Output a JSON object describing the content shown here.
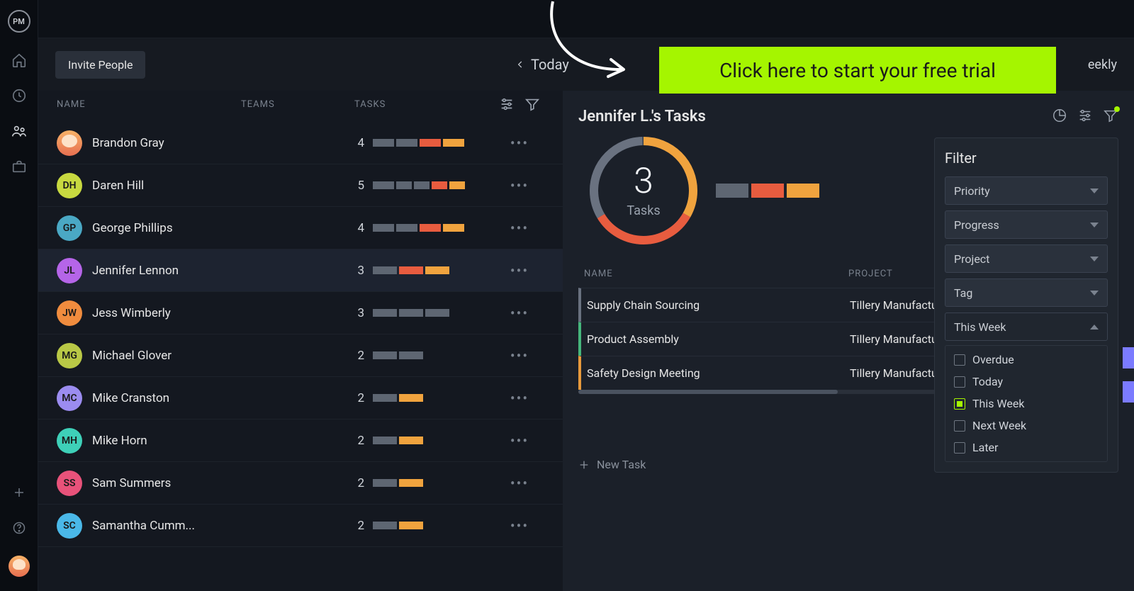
{
  "logo_text": "PM",
  "invite_label": "Invite People",
  "today_label": "Today",
  "view_label": "eekly",
  "cta_text": "Click here to start your free trial",
  "columns": {
    "name": "NAME",
    "teams": "TEAMS",
    "tasks": "TASKS"
  },
  "users": [
    {
      "name": "Brandon Gray",
      "initials": "",
      "color": "avatar-img",
      "tasks": 4,
      "bars": [
        [
          "gray",
          30
        ],
        [
          "gray",
          30
        ],
        [
          "red",
          30
        ],
        [
          "orange",
          30
        ]
      ],
      "selected": false,
      "avatarImg": true
    },
    {
      "name": "Daren Hill",
      "initials": "DH",
      "color": "#c8d940",
      "tasks": 5,
      "bars": [
        [
          "gray",
          30
        ],
        [
          "gray",
          22
        ],
        [
          "gray",
          22
        ],
        [
          "red",
          22
        ],
        [
          "orange",
          22
        ]
      ],
      "selected": false
    },
    {
      "name": "George Phillips",
      "initials": "GP",
      "color": "#4aa8c4",
      "tasks": 4,
      "bars": [
        [
          "gray",
          30
        ],
        [
          "gray",
          30
        ],
        [
          "red",
          30
        ],
        [
          "orange",
          30
        ]
      ],
      "selected": false
    },
    {
      "name": "Jennifer Lennon",
      "initials": "JL",
      "color": "#b565e8",
      "tasks": 3,
      "bars": [
        [
          "gray",
          34
        ],
        [
          "red",
          34
        ],
        [
          "orange",
          34
        ]
      ],
      "selected": true
    },
    {
      "name": "Jess Wimberly",
      "initials": "JW",
      "color": "#f08c3e",
      "tasks": 3,
      "bars": [
        [
          "gray",
          34
        ],
        [
          "gray",
          34
        ],
        [
          "gray",
          34
        ]
      ],
      "selected": false
    },
    {
      "name": "Michael Glover",
      "initials": "MG",
      "color": "#b9c846",
      "tasks": 2,
      "bars": [
        [
          "gray",
          34
        ],
        [
          "gray",
          34
        ]
      ],
      "selected": false
    },
    {
      "name": "Mike Cranston",
      "initials": "MC",
      "color": "#9b8cf0",
      "tasks": 2,
      "bars": [
        [
          "gray",
          34
        ],
        [
          "orange",
          34
        ]
      ],
      "selected": false
    },
    {
      "name": "Mike Horn",
      "initials": "MH",
      "color": "#3ed0b8",
      "tasks": 2,
      "bars": [
        [
          "gray",
          34
        ],
        [
          "orange",
          34
        ]
      ],
      "selected": false
    },
    {
      "name": "Sam Summers",
      "initials": "SS",
      "color": "#e8527a",
      "tasks": 2,
      "bars": [
        [
          "gray",
          34
        ],
        [
          "orange",
          34
        ]
      ],
      "selected": false
    },
    {
      "name": "Samantha Cumm...",
      "initials": "SC",
      "color": "#4ab8e8",
      "tasks": 2,
      "bars": [
        [
          "gray",
          34
        ],
        [
          "orange",
          34
        ]
      ],
      "selected": false
    }
  ],
  "detail": {
    "title": "Jennifer L.'s Tasks",
    "count": "3",
    "count_label": "Tasks",
    "mini_bars": [
      [
        "gray",
        46
      ],
      [
        "red",
        46
      ],
      [
        "orange",
        46
      ]
    ],
    "table_head": {
      "name": "NAME",
      "project": "PROJECT"
    },
    "tasks": [
      {
        "name": "Supply Chain Sourcing",
        "project": "Tillery Manufacturing",
        "border": "gray-l"
      },
      {
        "name": "Product Assembly",
        "project": "Tillery Manufacturing",
        "border": "green-l"
      },
      {
        "name": "Safety Design Meeting",
        "project": "Tillery Manufacturing",
        "border": "orange-l"
      }
    ],
    "new_task": "New Task"
  },
  "filter": {
    "title": "Filter",
    "selects": [
      "Priority",
      "Progress",
      "Project",
      "Tag"
    ],
    "open_select": "This Week",
    "options": [
      {
        "label": "Overdue",
        "checked": false
      },
      {
        "label": "Today",
        "checked": false
      },
      {
        "label": "This Week",
        "checked": true
      },
      {
        "label": "Next Week",
        "checked": false
      },
      {
        "label": "Later",
        "checked": false
      }
    ]
  },
  "chart_data": {
    "type": "pie",
    "title": "Jennifer L.'s Tasks",
    "values": [
      1,
      1,
      1
    ],
    "categories": [
      "gray",
      "red",
      "orange"
    ],
    "total_label": "3 Tasks"
  }
}
